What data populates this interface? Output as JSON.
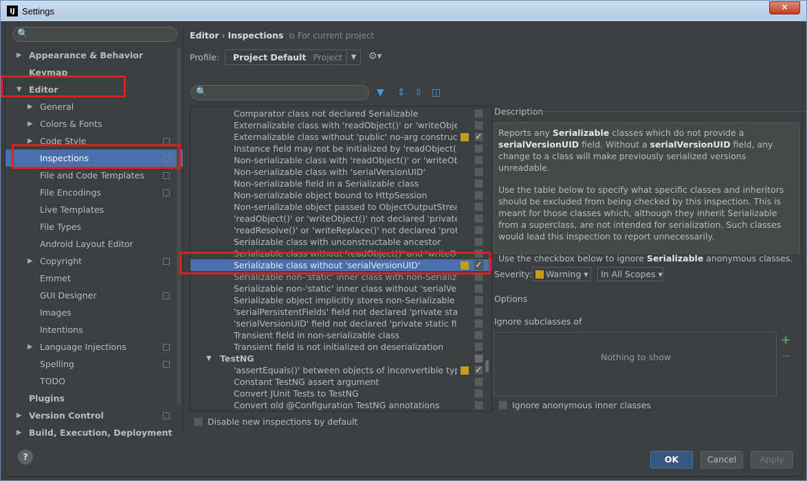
{
  "window": {
    "title": "Settings",
    "app_icon": "IJ"
  },
  "sidebar": {
    "items": [
      {
        "label": "Appearance & Behavior",
        "bold": true,
        "arrow": "▶",
        "indent": 0
      },
      {
        "label": "Keymap",
        "bold": true,
        "arrow": "",
        "indent": 0
      },
      {
        "label": "Editor",
        "bold": true,
        "arrow": "▼",
        "indent": 0
      },
      {
        "label": "General",
        "arrow": "▶",
        "indent": 1
      },
      {
        "label": "Colors & Fonts",
        "arrow": "▶",
        "indent": 1
      },
      {
        "label": "Code Style",
        "arrow": "▶",
        "indent": 1,
        "project": true
      },
      {
        "label": "Inspections",
        "arrow": "",
        "indent": 1,
        "project": true,
        "selected": true
      },
      {
        "label": "File and Code Templates",
        "arrow": "",
        "indent": 1,
        "project": true
      },
      {
        "label": "File Encodings",
        "arrow": "",
        "indent": 1,
        "project": true
      },
      {
        "label": "Live Templates",
        "arrow": "",
        "indent": 1
      },
      {
        "label": "File Types",
        "arrow": "",
        "indent": 1
      },
      {
        "label": "Android Layout Editor",
        "arrow": "",
        "indent": 1
      },
      {
        "label": "Copyright",
        "arrow": "▶",
        "indent": 1,
        "project": true
      },
      {
        "label": "Emmet",
        "arrow": "",
        "indent": 1
      },
      {
        "label": "GUI Designer",
        "arrow": "",
        "indent": 1,
        "project": true
      },
      {
        "label": "Images",
        "arrow": "",
        "indent": 1
      },
      {
        "label": "Intentions",
        "arrow": "",
        "indent": 1
      },
      {
        "label": "Language Injections",
        "arrow": "▶",
        "indent": 1,
        "project": true
      },
      {
        "label": "Spelling",
        "arrow": "",
        "indent": 1,
        "project": true
      },
      {
        "label": "TODO",
        "arrow": "",
        "indent": 1
      },
      {
        "label": "Plugins",
        "bold": true,
        "arrow": "",
        "indent": 0
      },
      {
        "label": "Version Control",
        "bold": true,
        "arrow": "▶",
        "indent": 0,
        "project": true
      },
      {
        "label": "Build, Execution, Deployment",
        "bold": true,
        "arrow": "▶",
        "indent": 0
      }
    ]
  },
  "header": {
    "crumb1": "Editor",
    "sep": "›",
    "crumb2": "Inspections",
    "scope": "For current project"
  },
  "profile": {
    "label": "Profile:",
    "value": "Project Default",
    "sub": "Project"
  },
  "inspections": [
    {
      "label": "Comparator class not declared Serializable",
      "sev": false,
      "on": false
    },
    {
      "label": "Externalizable class with 'readObject()' or 'writeObject()'",
      "sev": false,
      "on": false
    },
    {
      "label": "Externalizable class without 'public' no-arg constructor",
      "sev": true,
      "on": true
    },
    {
      "label": "Instance field may not be initialized by 'readObject()'",
      "sev": false,
      "on": false
    },
    {
      "label": "Non-serializable class with 'readObject()' or 'writeObject()'",
      "sev": false,
      "on": false
    },
    {
      "label": "Non-serializable class with 'serialVersionUID'",
      "sev": false,
      "on": false
    },
    {
      "label": "Non-serializable field in a Serializable class",
      "sev": false,
      "on": false
    },
    {
      "label": "Non-serializable object bound to HttpSession",
      "sev": false,
      "on": false
    },
    {
      "label": "Non-serializable object passed to ObjectOutputStream",
      "sev": false,
      "on": false
    },
    {
      "label": "'readObject()' or 'writeObject()' not declared 'private'",
      "sev": false,
      "on": false
    },
    {
      "label": "'readResolve()' or 'writeReplace()' not declared 'protected'",
      "sev": false,
      "on": false
    },
    {
      "label": "Serializable class with unconstructable ancestor",
      "sev": false,
      "on": false
    },
    {
      "label": "Serializable class without 'readObject()' and 'writeObject()'",
      "sev": false,
      "on": false,
      "faded": true
    },
    {
      "label": "Serializable class without 'serialVersionUID'",
      "sev": true,
      "on": true,
      "selected": true
    },
    {
      "label": "Serializable non-'static' inner class with non-Serializable outer",
      "sev": false,
      "on": false,
      "faded": true
    },
    {
      "label": "Serializable non-'static' inner class without 'serialVersionUID'",
      "sev": false,
      "on": false
    },
    {
      "label": "Serializable object implicitly stores non-Serializable object",
      "sev": false,
      "on": false
    },
    {
      "label": "'serialPersistentFields' field not declared 'private static final'",
      "sev": false,
      "on": false
    },
    {
      "label": "'serialVersionUID' field not declared 'private static final long'",
      "sev": false,
      "on": false
    },
    {
      "label": "Transient field in non-serializable class",
      "sev": false,
      "on": false
    },
    {
      "label": "Transient field is not initialized on deserialization",
      "sev": false,
      "on": false
    },
    {
      "label": "TestNG",
      "group": true,
      "sev": false,
      "on": false
    },
    {
      "label": "'assertEquals()' between objects of inconvertible types",
      "sev": true,
      "on": true
    },
    {
      "label": "Constant TestNG assert argument",
      "sev": false,
      "on": false
    },
    {
      "label": "Convert JUnit Tests to TestNG",
      "sev": false,
      "on": false
    },
    {
      "label": "Convert old @Configuration TestNG annotations",
      "sev": false,
      "on": false
    }
  ],
  "disable_new": "Disable new inspections by default",
  "description": {
    "label": "Description",
    "p1a": "Reports any ",
    "p1b": "Serializable",
    "p1c": " classes which do not provide a ",
    "p1d": "serialVersionUID",
    "p1e": " field. Without a ",
    "p1f": "serialVersionUID",
    "p1g": " field, any change to a class will make previously serialized versions unreadable.",
    "p2": "Use the table below to specify what specific classes and inheritors should be excluded from being checked by this inspection. This is meant for those classes which, although they inherit Serializable from a superclass, are not intended for serialization. Such classes would lead this inspection to report unnecessarily.",
    "p3a": "Use the checkbox below to ignore ",
    "p3b": "Serializable",
    "p3c": " anonymous classes."
  },
  "severity": {
    "label": "Severity:",
    "value": "Warning",
    "scope": "In All Scopes",
    "color": "#c99b1b"
  },
  "options": {
    "label": "Options",
    "ignore_label": "Ignore subclasses of",
    "empty": "Nothing to show",
    "anon": "Ignore anonymous inner classes"
  },
  "buttons": {
    "ok": "OK",
    "cancel": "Cancel",
    "apply": "Apply",
    "help": "?"
  },
  "accent": "#4b6eaf"
}
